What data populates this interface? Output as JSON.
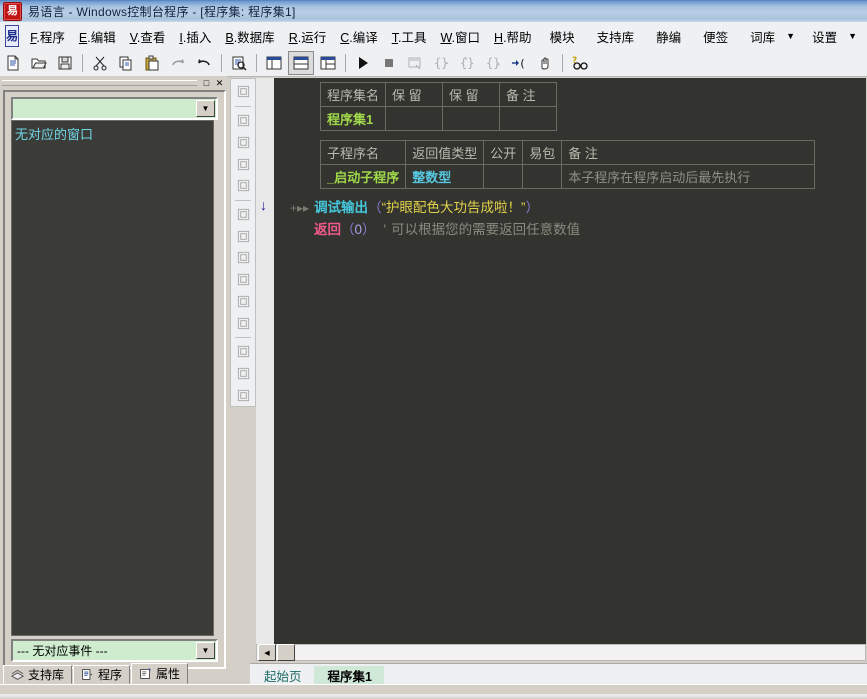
{
  "window": {
    "title": "易语言 - Windows控制台程序 - [程序集: 程序集1]",
    "app_icon": "易",
    "logo_icon": "易"
  },
  "menubar": {
    "items": [
      {
        "name": "menu-program",
        "acc": "F",
        "label": ".程序"
      },
      {
        "name": "menu-edit",
        "acc": "E",
        "label": ".编辑"
      },
      {
        "name": "menu-view",
        "acc": "V",
        "label": ".查看"
      },
      {
        "name": "menu-insert",
        "acc": "I",
        "label": ".插入"
      },
      {
        "name": "menu-database",
        "acc": "B",
        "label": ".数据库"
      },
      {
        "name": "menu-run",
        "acc": "R",
        "label": ".运行"
      },
      {
        "name": "menu-compile",
        "acc": "C",
        "label": ".编译"
      },
      {
        "name": "menu-tools",
        "acc": "T",
        "label": ".工具"
      },
      {
        "name": "menu-window",
        "acc": "W",
        "label": ".窗口"
      },
      {
        "name": "menu-help",
        "acc": "H",
        "label": ".帮助"
      }
    ],
    "right_items": [
      {
        "name": "menu-module",
        "label": "模块",
        "caret": false
      },
      {
        "name": "menu-libs",
        "label": "支持库",
        "caret": false
      },
      {
        "name": "menu-static",
        "label": "静编",
        "caret": false
      },
      {
        "name": "menu-note",
        "label": "便签",
        "caret": false
      },
      {
        "name": "menu-lexicon",
        "label": "词库",
        "caret": true
      },
      {
        "name": "menu-settings",
        "label": "设置",
        "caret": true
      }
    ],
    "caret_glyph": "▼"
  },
  "toolbar": {
    "buttons": [
      {
        "name": "new-file-button",
        "icon": "new-file-icon"
      },
      {
        "name": "open-file-button",
        "icon": "open-folder-icon"
      },
      {
        "name": "save-file-button",
        "icon": "save-disk-icon"
      },
      {
        "name": "cut-button",
        "icon": "scissors-icon"
      },
      {
        "name": "copy-button",
        "icon": "copy-icon"
      },
      {
        "name": "paste-button",
        "icon": "clipboard-icon"
      },
      {
        "name": "redo-button",
        "icon": "redo-arrow-icon"
      },
      {
        "name": "undo-button",
        "icon": "undo-arrow-icon"
      },
      {
        "name": "find-button",
        "icon": "find-document-icon"
      },
      {
        "name": "layout-left-button",
        "icon": "layout-left-icon"
      },
      {
        "name": "layout-top-button",
        "icon": "layout-top-icon"
      },
      {
        "name": "layout-grid-button",
        "icon": "layout-grid-icon"
      },
      {
        "name": "run-button",
        "icon": "play-triangle-icon"
      },
      {
        "name": "stop-button",
        "icon": "stop-square-icon"
      },
      {
        "name": "debug-window-button",
        "icon": "debug-window-icon"
      },
      {
        "name": "step-into-button",
        "icon": "step-into-icon"
      },
      {
        "name": "step-over-button",
        "icon": "step-over-icon"
      },
      {
        "name": "step-out-button",
        "icon": "step-out-icon"
      },
      {
        "name": "run-to-cursor-button",
        "icon": "run-to-cursor-icon"
      },
      {
        "name": "pause-hand-button",
        "icon": "hand-icon"
      },
      {
        "name": "search-help-button",
        "icon": "binoculars-help-icon"
      }
    ]
  },
  "left_panel": {
    "caption_restore": "□",
    "caption_close": "✕",
    "window_combo": {
      "value": "",
      "placeholder": ""
    },
    "canvas_text": "无对应的窗口",
    "event_combo": {
      "value": "--- 无对应事件 ---"
    },
    "tabs": [
      {
        "name": "sidebar-tab-libs",
        "label": "支持库",
        "icon": "books-icon",
        "active": false
      },
      {
        "name": "sidebar-tab-program",
        "label": "程序",
        "icon": "program-icon",
        "active": false
      },
      {
        "name": "sidebar-tab-props",
        "label": "属性",
        "icon": "properties-icon",
        "active": true
      }
    ]
  },
  "align_toolbar": {
    "buttons": [
      {
        "name": "align-frame-button",
        "icon": "frame-icon"
      },
      {
        "name": "align-left-button",
        "icon": "align-left-icon"
      },
      {
        "name": "align-right-button",
        "icon": "align-right-icon"
      },
      {
        "name": "align-top-button",
        "icon": "align-top-icon"
      },
      {
        "name": "align-bottom-button",
        "icon": "align-bottom-icon"
      },
      {
        "name": "center-horizontal-button",
        "icon": "center-horizontal-icon"
      },
      {
        "name": "center-vertical-button",
        "icon": "center-vertical-icon"
      },
      {
        "name": "same-width-button",
        "icon": "same-width-icon"
      },
      {
        "name": "same-height-button",
        "icon": "same-height-icon"
      },
      {
        "name": "space-horizontal-button",
        "icon": "space-horizontal-icon"
      },
      {
        "name": "space-vertical-button",
        "icon": "space-vertical-icon"
      },
      {
        "name": "size-width-button",
        "icon": "size-width-icon"
      },
      {
        "name": "size-height-button",
        "icon": "size-height-icon"
      },
      {
        "name": "size-both-button",
        "icon": "size-both-icon"
      }
    ]
  },
  "code_area": {
    "assembly_table": {
      "headers": [
        "程序集名",
        "保 留",
        "保 留",
        "备 注"
      ],
      "row": [
        "程序集1",
        "",
        "",
        ""
      ]
    },
    "subroutine_table": {
      "headers": [
        "子程序名",
        "返回值类型",
        "公开",
        "易包",
        "备 注"
      ],
      "row": {
        "name": "_启动子程序",
        "return_type": "整数型",
        "public": "",
        "package": "",
        "note": "本子程序在程序启动后最先执行"
      }
    },
    "lines": [
      {
        "name": "code-line-debug-output",
        "marker": "↓",
        "fold": "+▸▸",
        "keyword": "调试输出",
        "lparen": "（",
        "string": "“护眼配色大功告成啦！”",
        "rparen": "）",
        "comment": ""
      },
      {
        "name": "code-line-return",
        "keyword": "返回",
        "lparen": "（",
        "number": "0",
        "rparen": "）",
        "tick": "'",
        "comment": "可以根据您的需要返回任意数值"
      }
    ],
    "colors": {
      "background": "#33332f",
      "keyword_cyan": "#45c8dc",
      "keyword_pink": "#f05a8c",
      "string": "#e0d24a",
      "comment": "#8a8a7e",
      "number": "#b0a0ee",
      "identifier_green": "#9fd74a",
      "type_blue": "#57c8e0"
    }
  },
  "hscroll": {
    "left_arrow": "◀",
    "right_arrow": "▶"
  },
  "doc_tabs": [
    {
      "name": "doc-tab-start-page",
      "label": "起始页",
      "active": false
    },
    {
      "name": "doc-tab-assembly1",
      "label": "程序集1",
      "active": true
    }
  ]
}
